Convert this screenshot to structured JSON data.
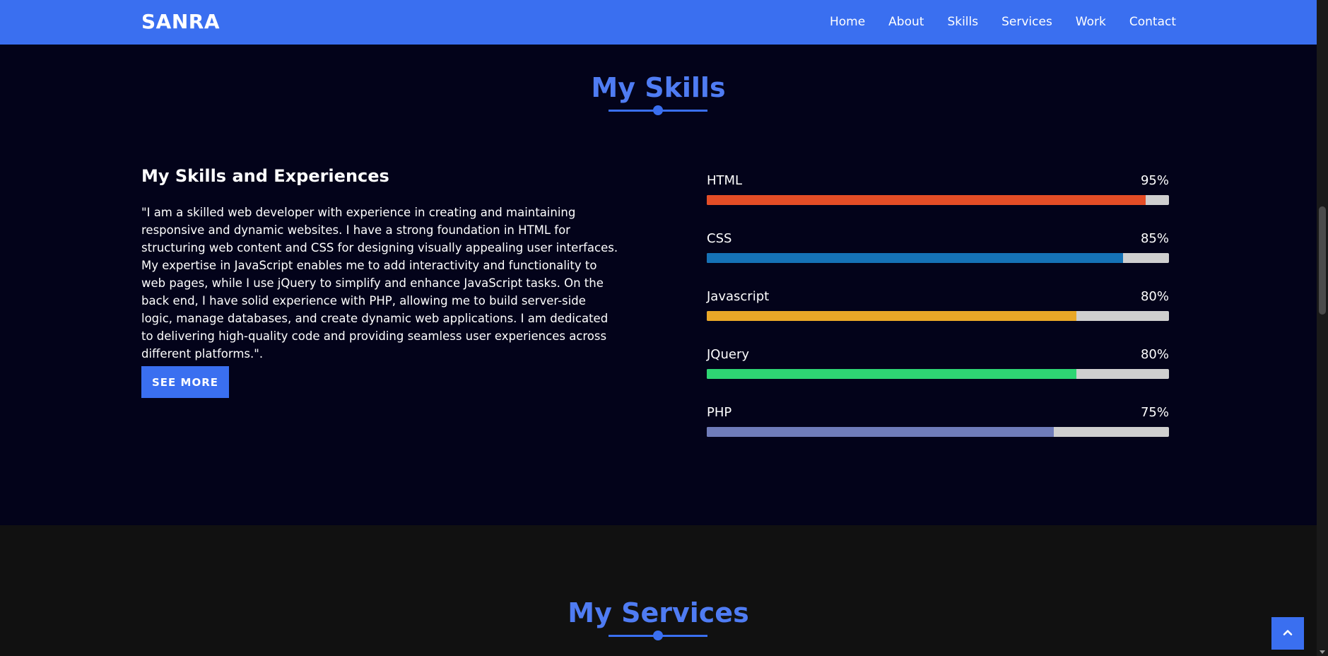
{
  "navbar": {
    "brand": "SANRA",
    "links": [
      "Home",
      "About",
      "Skills",
      "Services",
      "Work",
      "Contact"
    ]
  },
  "skills_section": {
    "title": "My Skills",
    "heading": "My Skills and Experiences",
    "description": "\"I am a skilled web developer with experience in creating and maintaining responsive and dynamic websites. I have a strong foundation in HTML for structuring web content and CSS for designing visually appealing user interfaces. My expertise in JavaScript enables me to add interactivity and functionality to web pages, while I use jQuery to simplify and enhance JavaScript tasks. On the back end, I have solid experience with PHP, allowing me to build server-side logic, manage databases, and create dynamic web applications. I am dedicated to delivering high-quality code and providing seamless user experiences across different platforms.\".",
    "button_label": "SEE MORE",
    "skills": [
      {
        "name": "HTML",
        "percent_label": "95%",
        "level": 95,
        "color": "#e44d26"
      },
      {
        "name": "CSS",
        "percent_label": "85%",
        "level": 90,
        "color": "#1572b6"
      },
      {
        "name": "Javascript",
        "percent_label": "80%",
        "level": 80,
        "color": "#e9a727"
      },
      {
        "name": "JQuery",
        "percent_label": "80%",
        "level": 80,
        "color": "#2ed573"
      },
      {
        "name": "PHP",
        "percent_label": "75%",
        "level": 75,
        "color": "#6f7cba"
      }
    ]
  },
  "services_section": {
    "title": "My Services"
  },
  "icons": {
    "back_to_top": "chevron-up-icon"
  },
  "colors": {
    "accent": "#3a6ff0",
    "title": "#4f7cf3",
    "background": "#03031a",
    "services_background": "#111111"
  }
}
